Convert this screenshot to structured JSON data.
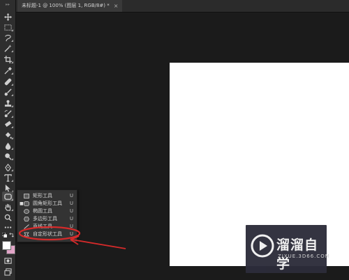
{
  "document_tab": {
    "title": "未标题-1 @ 100% (图层 1, RGB/8#) *",
    "close_label": "×"
  },
  "toolbar": {
    "grip": "▸▸",
    "tools": [
      "move-tool",
      "marquee-tool",
      "lasso-tool",
      "quick-select-tool",
      "crop-tool",
      "eyedropper-tool",
      "healing-brush-tool",
      "brush-tool",
      "clone-stamp-tool",
      "history-brush-tool",
      "eraser-tool",
      "paint-bucket-tool",
      "blur-tool",
      "dodge-tool",
      "pen-tool",
      "type-tool",
      "path-selection-tool",
      "shape-tool",
      "hand-tool",
      "zoom-tool",
      "more-tools"
    ],
    "active_tool": "shape-tool",
    "foreground_color": "#ffffff",
    "background_color": "#e2a5c8"
  },
  "shape_flyout": {
    "items": [
      {
        "label": "矩形工具",
        "shortcut": "U",
        "icon": "rectangle-icon",
        "selected": false
      },
      {
        "label": "圆角矩形工具",
        "shortcut": "U",
        "icon": "rounded-rectangle-icon",
        "selected": true
      },
      {
        "label": "椭圆工具",
        "shortcut": "U",
        "icon": "ellipse-icon",
        "selected": false
      },
      {
        "label": "多边形工具",
        "shortcut": "U",
        "icon": "polygon-icon",
        "selected": false
      },
      {
        "label": "直线工具",
        "shortcut": "U",
        "icon": "line-icon",
        "selected": false
      },
      {
        "label": "自定形状工具",
        "shortcut": "U",
        "icon": "custom-shape-icon",
        "selected": false
      }
    ],
    "selected_marker": "■"
  },
  "annotation": {
    "color": "#d62a2a"
  },
  "watermark": {
    "title": "溜溜自学",
    "url": "ZIXUE.3D66.COM"
  }
}
